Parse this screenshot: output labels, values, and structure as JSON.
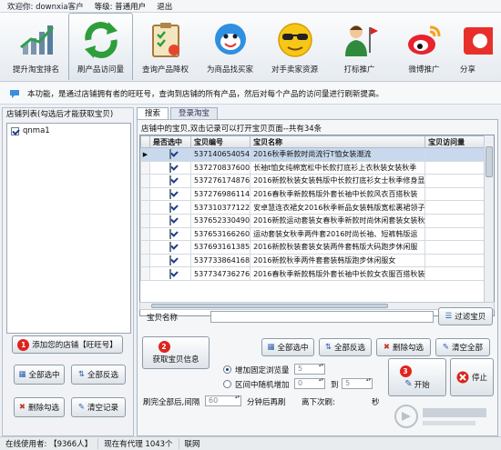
{
  "menu": {
    "welcome": "欢迎你: downxia客户",
    "level": "等级: 普通用户",
    "exit": "退出"
  },
  "toolbar": [
    {
      "label": "提升淘宝排名",
      "icon": "bar-chart-icon"
    },
    {
      "label": "刷产品访问量",
      "icon": "recycle-arrows-icon"
    },
    {
      "label": "查询产品降权",
      "icon": "clipboard-check-icon"
    },
    {
      "label": "为商品找买家",
      "icon": "smiley-chat-icon"
    },
    {
      "label": "对手卖家资源",
      "icon": "sunglasses-face-icon"
    },
    {
      "label": "打标推广",
      "icon": "person-flag-icon"
    },
    {
      "label": "微博推广",
      "icon": "weibo-icon"
    },
    {
      "label": "分享",
      "icon": "share-icon"
    }
  ],
  "info": "本功能，是通过店铺拥有者的旺旺号，查询到店铺的所有产品，然后对每个产品的访问量进行刷新提高。",
  "left": {
    "title": "店铺列表(勾选后才能获取宝贝)",
    "shops": [
      "qnma1"
    ],
    "add_shop": "添加您的店铺【旺旺号】",
    "select_all": "全部选中",
    "invert": "全部反选",
    "delete_checked": "删除勾选",
    "clear": "清空记录"
  },
  "tabs": [
    "搜索",
    "登录淘宝"
  ],
  "grid": {
    "caption": "店铺中的宝贝,双击记录可以打开宝贝页面--共有34条",
    "columns": [
      "是否选中",
      "宝贝编号",
      "宝贝名称",
      "宝贝访问量"
    ],
    "rows": [
      {
        "id": "537140654054",
        "name": "2016秋季新款时尚流行T恤女装潮流"
      },
      {
        "id": "537270837600",
        "name": "长袖t恤女纯棉宽松中长款打底衫上衣秋装女装秋季"
      },
      {
        "id": "537276174876",
        "name": "2016新款秋装女装韩版中长款打底衫女士秋季修身显"
      },
      {
        "id": "537276986114",
        "name": "2016春秋季新款韩版外套长袖中长款风衣百搭秋装"
      },
      {
        "id": "537310377122",
        "name": "安卓慧连衣裙女2016秋季新品女装韩版宽松裹裙领子"
      },
      {
        "id": "537652330490",
        "name": "2016新款运动套装女春秋季新款时尚休闲套装女装秋"
      },
      {
        "id": "537653166260",
        "name": "运动套装女秋季两件套2016时尚长袖、短裤韩版运"
      },
      {
        "id": "537693161385",
        "name": "2016新款秋装套装女装两件套韩版大码跑步休闲服"
      },
      {
        "id": "537733864168",
        "name": "2016新款秋季两件套套装韩版跑步休闲服女"
      },
      {
        "id": "537734736276",
        "name": "2016春秋季新款韩版外套长袖中长款女衣服百搭秋装"
      }
    ]
  },
  "filter": {
    "label": "宝贝名称",
    "value": "",
    "button": "过滤宝贝"
  },
  "actions": {
    "get_items": "获取宝贝信息",
    "select_all": "全部选中",
    "invert": "全部反选",
    "delete_checked": "删除勾选",
    "clear_all": "清空全部",
    "add_fixed": "增加固定浏览量",
    "fixed_value": "5",
    "random_range": "区间中随机增加",
    "random_from": "0",
    "to": "到",
    "random_to": "5",
    "start": "开始",
    "stop": "停止",
    "refresh_prefix": "刷完全部后,间隔",
    "interval": "60",
    "refresh_suffix": "分钟后再刷",
    "countdown": "离下次刷:",
    "seconds": "秒"
  },
  "status": {
    "users": "在线使用者: 【9366人】",
    "agents": "现在有代理 1043个",
    "network": "联网"
  },
  "badges": [
    "1",
    "2",
    "3"
  ]
}
